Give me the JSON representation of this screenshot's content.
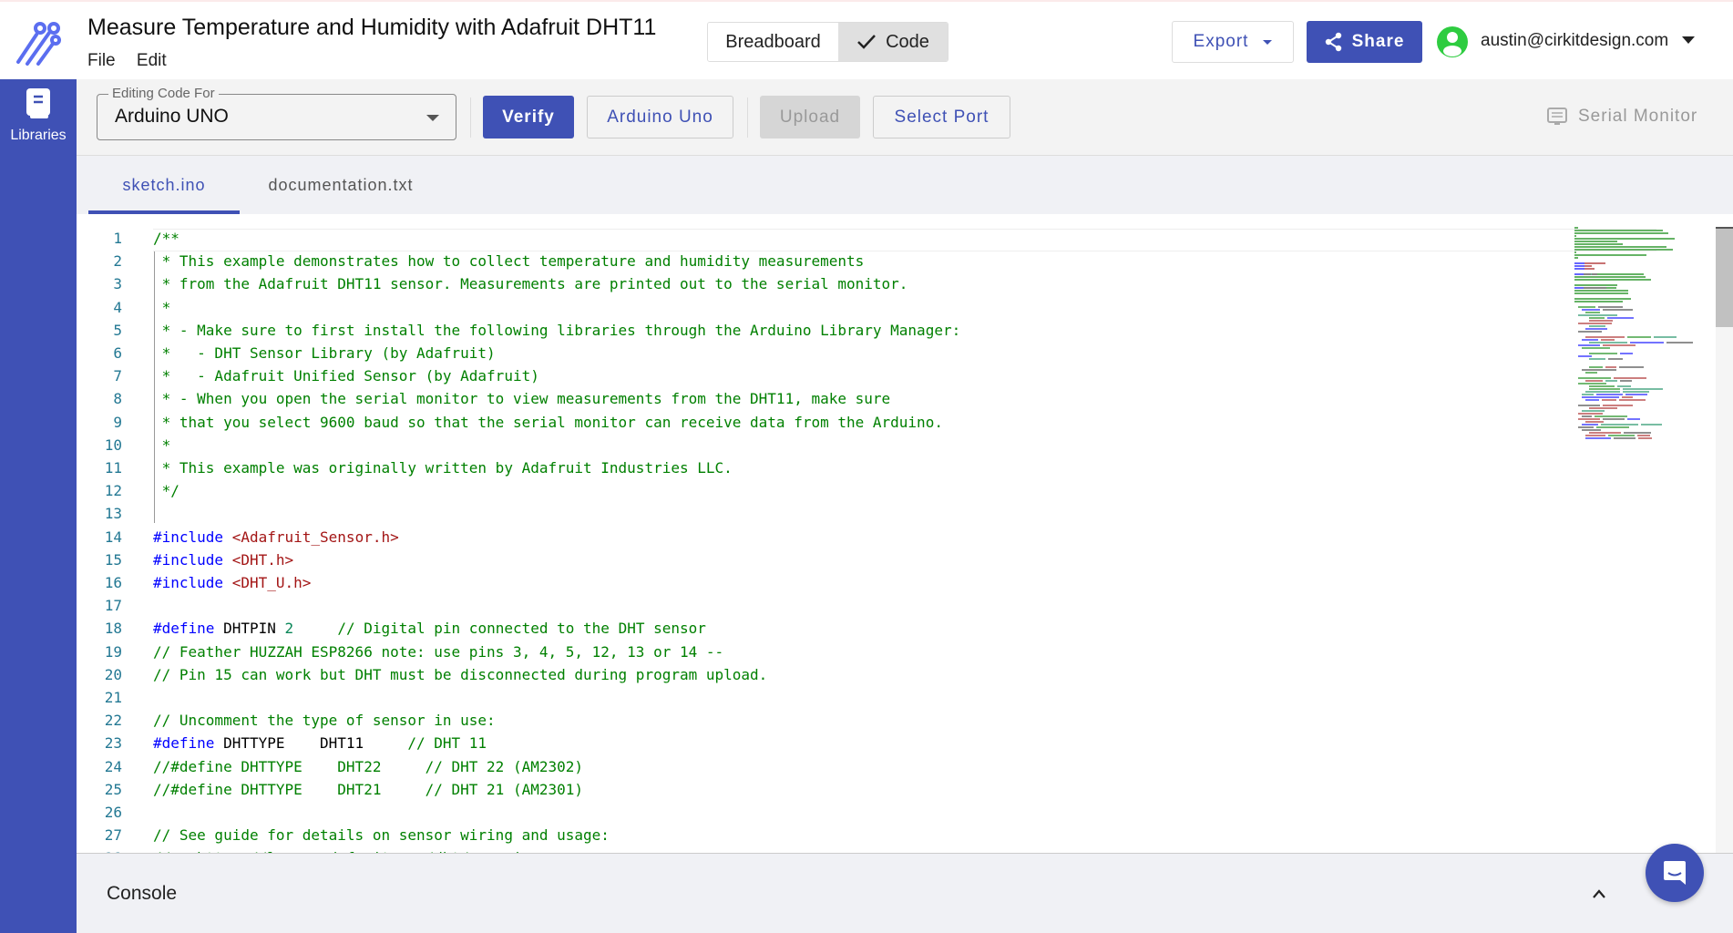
{
  "header": {
    "title": "Measure Temperature and Humidity with Adafruit DHT11",
    "menu": [
      "File",
      "Edit"
    ],
    "view_toggle": {
      "breadboard": "Breadboard",
      "code": "Code",
      "selected": "Code"
    },
    "export_label": "Export",
    "share_label": "Share",
    "user_email": "austin@cirkitdesign.com"
  },
  "sidebar": {
    "libraries_label": "Libraries"
  },
  "toolbar": {
    "board_legend": "Editing Code For",
    "board_value": "Arduino UNO",
    "verify_label": "Verify",
    "board_button_label": "Arduino Uno",
    "upload_label": "Upload",
    "select_port_label": "Select Port",
    "serial_monitor_label": "Serial Monitor"
  },
  "tabs": [
    {
      "label": "sketch.ino",
      "active": true
    },
    {
      "label": "documentation.txt",
      "active": false
    }
  ],
  "colors": {
    "accent": "#3f51b5",
    "comment": "#008000",
    "keyword": "#0000ff",
    "string": "#a31515",
    "number": "#098658",
    "line_number": "#237893",
    "avatar": "#2ecc40"
  },
  "code_lines": [
    [
      [
        "c",
        "/**"
      ]
    ],
    [
      [
        "c",
        " * This example demonstrates how to collect temperature and humidity measurements"
      ]
    ],
    [
      [
        "c",
        " * from the Adafruit DHT11 sensor. Measurements are printed out to the serial monitor."
      ]
    ],
    [
      [
        "c",
        " *"
      ]
    ],
    [
      [
        "c",
        " * - Make sure to first install the following libraries through the Arduino Library Manager:"
      ]
    ],
    [
      [
        "c",
        " *   - DHT Sensor Library (by Adafruit)"
      ]
    ],
    [
      [
        "c",
        " *   - Adafruit Unified Sensor (by Adafruit)"
      ]
    ],
    [
      [
        "c",
        " * - When you open the serial monitor to view measurements from the DHT11, make sure"
      ]
    ],
    [
      [
        "c",
        " * that you select 9600 baud so that the serial monitor can receive data from the Arduino."
      ]
    ],
    [
      [
        "c",
        " *"
      ]
    ],
    [
      [
        "c",
        " * This example was originally written by Adafruit Industries LLC."
      ]
    ],
    [
      [
        "c",
        " */"
      ]
    ],
    [],
    [
      [
        "k",
        "#include "
      ],
      [
        "s",
        "<Adafruit_Sensor.h>"
      ]
    ],
    [
      [
        "k",
        "#include "
      ],
      [
        "s",
        "<DHT.h>"
      ]
    ],
    [
      [
        "k",
        "#include "
      ],
      [
        "s",
        "<DHT_U.h>"
      ]
    ],
    [],
    [
      [
        "k",
        "#define "
      ],
      [
        "p",
        "DHTPIN "
      ],
      [
        "n",
        "2"
      ],
      [
        "p",
        "     "
      ],
      [
        "c",
        "// Digital pin connected to the DHT sensor"
      ]
    ],
    [
      [
        "c",
        "// Feather HUZZAH ESP8266 note: use pins 3, 4, 5, 12, 13 or 14 --"
      ]
    ],
    [
      [
        "c",
        "// Pin 15 can work but DHT must be disconnected during program upload."
      ]
    ],
    [],
    [
      [
        "c",
        "// Uncomment the type of sensor in use:"
      ]
    ],
    [
      [
        "k",
        "#define "
      ],
      [
        "p",
        "DHTTYPE    DHT11     "
      ],
      [
        "c",
        "// DHT 11"
      ]
    ],
    [
      [
        "c",
        "//#define DHTTYPE    DHT22     // DHT 22 (AM2302)"
      ]
    ],
    [
      [
        "c",
        "//#define DHTTYPE    DHT21     // DHT 21 (AM2301)"
      ]
    ],
    [],
    [
      [
        "c",
        "// See guide for details on sensor wiring and usage:"
      ]
    ],
    [
      [
        "c",
        "//   https://learn.adafruit.com/dht/overview"
      ]
    ]
  ],
  "console": {
    "label": "Console"
  }
}
